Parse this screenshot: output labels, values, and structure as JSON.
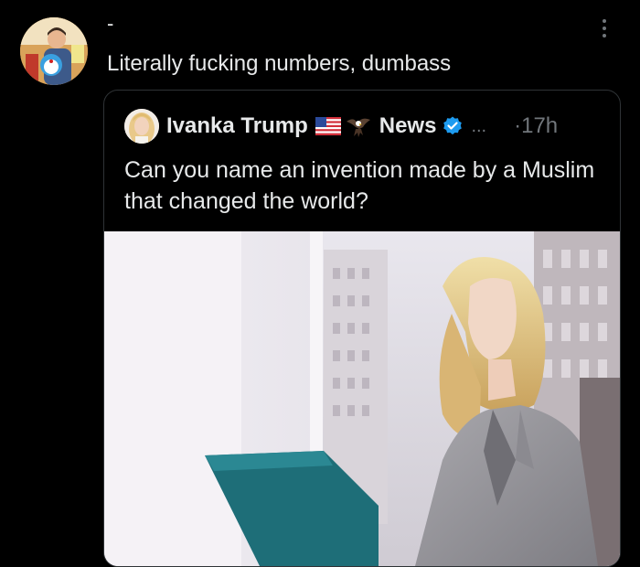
{
  "post": {
    "username": "-",
    "text": "Literally fucking numbers, dumbass",
    "avatar_icon": "user-avatar-photo",
    "more_icon": "more-options-icon"
  },
  "quote": {
    "author_name": "Ivanka Trump",
    "flag_icon": "us-flag-icon",
    "eagle_icon": "eagle-icon",
    "secondary_name": "News",
    "verified_icon": "verified-badge-icon",
    "ellipsis": "...",
    "time": "·17h",
    "text": "Can you name an invention made by a Muslim that changed the world?",
    "image_description_icon": "photo-woman-in-office"
  },
  "colors": {
    "background": "#000000",
    "text": "#e7e9ea",
    "muted": "#71767b",
    "border": "#2f3336",
    "verified": "#1d9bf0"
  }
}
